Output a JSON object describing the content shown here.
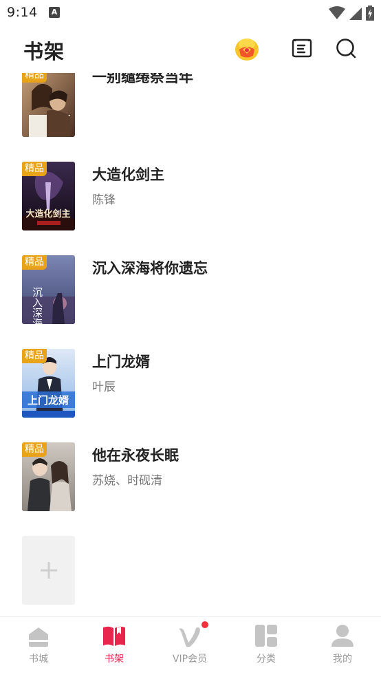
{
  "status_bar": {
    "time": "9:14",
    "notification_letter": "A"
  },
  "header": {
    "title": "书架"
  },
  "books": [
    {
      "badge": "精品",
      "title": "一别缱绻祭当年",
      "author": ""
    },
    {
      "badge": "精品",
      "title": "大造化剑主",
      "author": "陈锋"
    },
    {
      "badge": "精品",
      "title": "沉入深海将你遗忘",
      "author": ""
    },
    {
      "badge": "精品",
      "title": "上门龙婿",
      "author": "叶辰"
    },
    {
      "badge": "精品",
      "title": "他在永夜长眠",
      "author": "苏娆、时砚清"
    }
  ],
  "nav": [
    {
      "label": "书城"
    },
    {
      "label": "书架"
    },
    {
      "label": "VIP会员"
    },
    {
      "label": "分类"
    },
    {
      "label": "我的"
    }
  ],
  "colors": {
    "accent": "#e8264d",
    "badge": "#e8a317",
    "inactive": "#999999"
  }
}
